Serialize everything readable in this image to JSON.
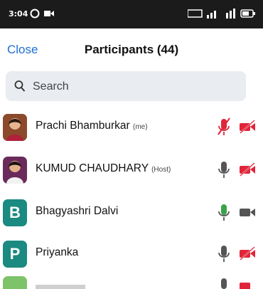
{
  "status_bar": {
    "time": "3:04"
  },
  "header": {
    "close_label": "Close",
    "title": "Participants (44)"
  },
  "search": {
    "placeholder": "Search"
  },
  "participants": [
    {
      "name": "Prachi Bhamburkar",
      "tag": "(me)",
      "avatar": "photo",
      "mic": "muted",
      "video": "off"
    },
    {
      "name": "KUMUD CHAUDHARY",
      "tag": "(Host)",
      "avatar": "photo",
      "mic": "on",
      "video": "off"
    },
    {
      "name": "Bhagyashri Dalvi",
      "tag": "",
      "avatar_letter": "B",
      "mic": "on",
      "video": "on"
    },
    {
      "name": "Priyanka",
      "tag": "",
      "avatar_letter": "P",
      "mic": "on",
      "video": "off"
    }
  ],
  "colors": {
    "accent": "#1d6fd1",
    "muted_red": "#e0253a",
    "speaking_green": "#3aa34a",
    "avatar_teal": "#1b8a80",
    "avatar_green": "#7cc36a"
  }
}
